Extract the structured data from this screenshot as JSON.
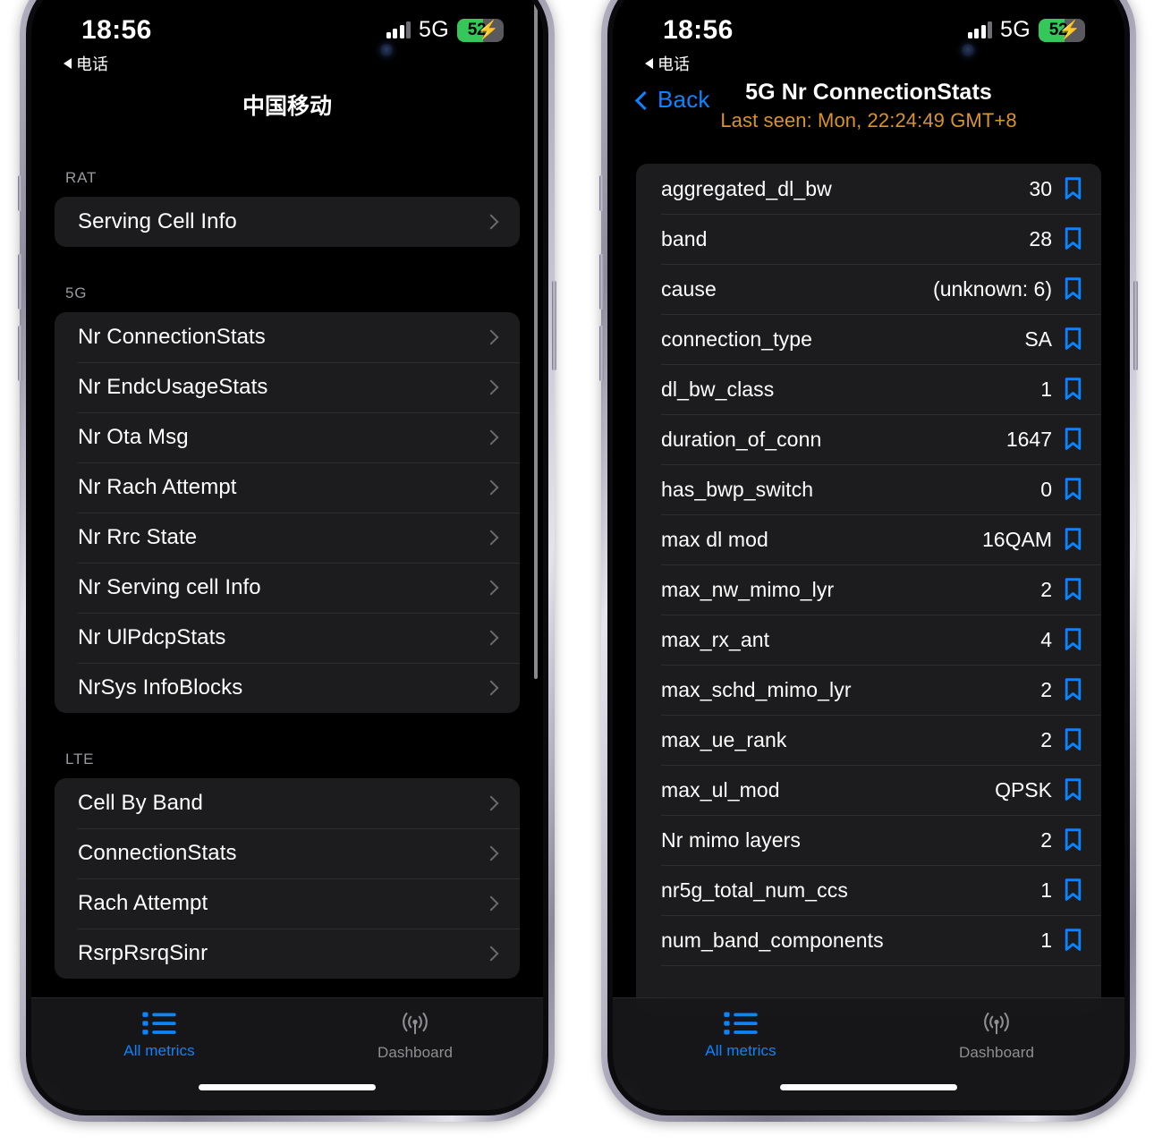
{
  "status_bar": {
    "time": "18:56",
    "back_app_label": "电话",
    "network": "5G",
    "battery_percent": "52",
    "battery_charging_icon": "bolt-icon",
    "signal_icon": "signal-bars-icon"
  },
  "left_phone": {
    "nav_title": "中国移动",
    "sections": [
      {
        "header": "RAT",
        "items": [
          {
            "label": "Serving Cell Info"
          }
        ]
      },
      {
        "header": "5G",
        "items": [
          {
            "label": "Nr ConnectionStats"
          },
          {
            "label": "Nr EndcUsageStats"
          },
          {
            "label": "Nr Ota Msg"
          },
          {
            "label": "Nr Rach Attempt"
          },
          {
            "label": "Nr Rrc State"
          },
          {
            "label": "Nr Serving cell Info"
          },
          {
            "label": "Nr UlPdcpStats"
          },
          {
            "label": "NrSys InfoBlocks"
          }
        ]
      },
      {
        "header": "LTE",
        "items": [
          {
            "label": "Cell By Band"
          },
          {
            "label": "ConnectionStats"
          },
          {
            "label": "Rach Attempt"
          },
          {
            "label": "RsrpRsrqSinr"
          }
        ]
      }
    ]
  },
  "right_phone": {
    "back_label": "Back",
    "nav_title": "5G Nr ConnectionStats",
    "nav_subtitle": "Last seen: Mon, 22:24:49 GMT+8",
    "rows": [
      {
        "key": "aggregated_dl_bw",
        "value": "30"
      },
      {
        "key": "band",
        "value": "28"
      },
      {
        "key": "cause",
        "value": "(unknown: 6)"
      },
      {
        "key": "connection_type",
        "value": "SA"
      },
      {
        "key": "dl_bw_class",
        "value": "1"
      },
      {
        "key": "duration_of_conn",
        "value": "1647"
      },
      {
        "key": "has_bwp_switch",
        "value": "0"
      },
      {
        "key": "max dl mod",
        "value": "16QAM"
      },
      {
        "key": "max_nw_mimo_lyr",
        "value": "2"
      },
      {
        "key": "max_rx_ant",
        "value": "4"
      },
      {
        "key": "max_schd_mimo_lyr",
        "value": "2"
      },
      {
        "key": "max_ue_rank",
        "value": "2"
      },
      {
        "key": "max_ul_mod",
        "value": "QPSK"
      },
      {
        "key": "Nr mimo layers",
        "value": "2"
      },
      {
        "key": "nr5g_total_num_ccs",
        "value": "1"
      },
      {
        "key": "num_band_components",
        "value": "1"
      }
    ]
  },
  "tab_bar": {
    "tabs": [
      {
        "label": "All metrics",
        "icon": "list-bullet-icon",
        "active": true
      },
      {
        "label": "Dashboard",
        "icon": "antenna-broadcast-icon",
        "active": false
      }
    ]
  },
  "colors": {
    "accent_blue": "#0a84ff",
    "subtitle_orange": "#d9932a",
    "battery_green": "#34c759",
    "card_bg": "#1c1c1e",
    "screen_bg": "#000000"
  }
}
